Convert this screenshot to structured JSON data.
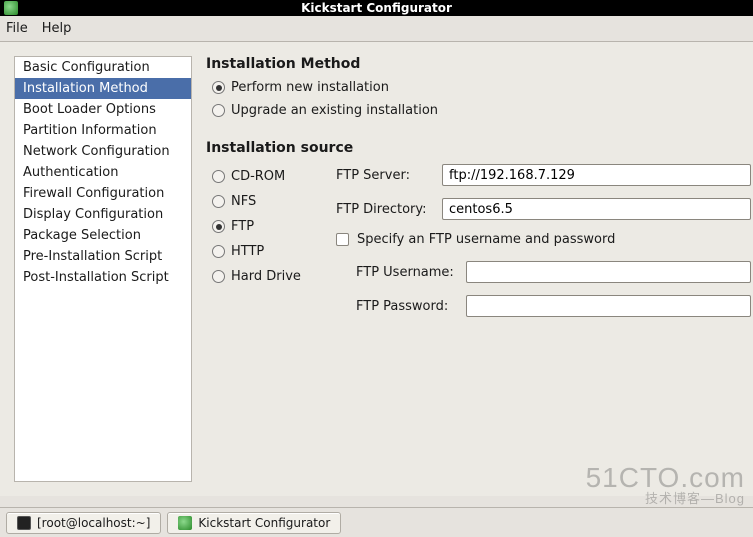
{
  "window": {
    "title": "Kickstart Configurator"
  },
  "menu": {
    "file": "File",
    "help": "Help"
  },
  "sidebar": {
    "items": [
      "Basic Configuration",
      "Installation Method",
      "Boot Loader Options",
      "Partition Information",
      "Network Configuration",
      "Authentication",
      "Firewall Configuration",
      "Display Configuration",
      "Package Selection",
      "Pre-Installation Script",
      "Post-Installation Script"
    ],
    "selected_index": 1
  },
  "install_method": {
    "heading": "Installation Method",
    "options": {
      "perform": "Perform new installation",
      "upgrade": "Upgrade an existing installation"
    },
    "selected": "perform"
  },
  "install_source": {
    "heading": "Installation source",
    "options": {
      "cdrom": "CD-ROM",
      "nfs": "NFS",
      "ftp": "FTP",
      "http": "HTTP",
      "harddrive": "Hard Drive"
    },
    "selected": "ftp",
    "ftp": {
      "server_label": "FTP Server:",
      "server_value": "ftp://192.168.7.129",
      "dir_label": "FTP Directory:",
      "dir_value": "centos6.5",
      "auth_checkbox": "Specify an FTP username and password",
      "auth_checked": false,
      "user_label": "FTP Username:",
      "user_value": "",
      "pass_label": "FTP Password:",
      "pass_value": ""
    }
  },
  "taskbar": {
    "terminal": "[root@localhost:~]",
    "app": "Kickstart Configurator"
  },
  "watermark": {
    "main": "51CTO.com",
    "sub": "技术博客—Blog"
  }
}
